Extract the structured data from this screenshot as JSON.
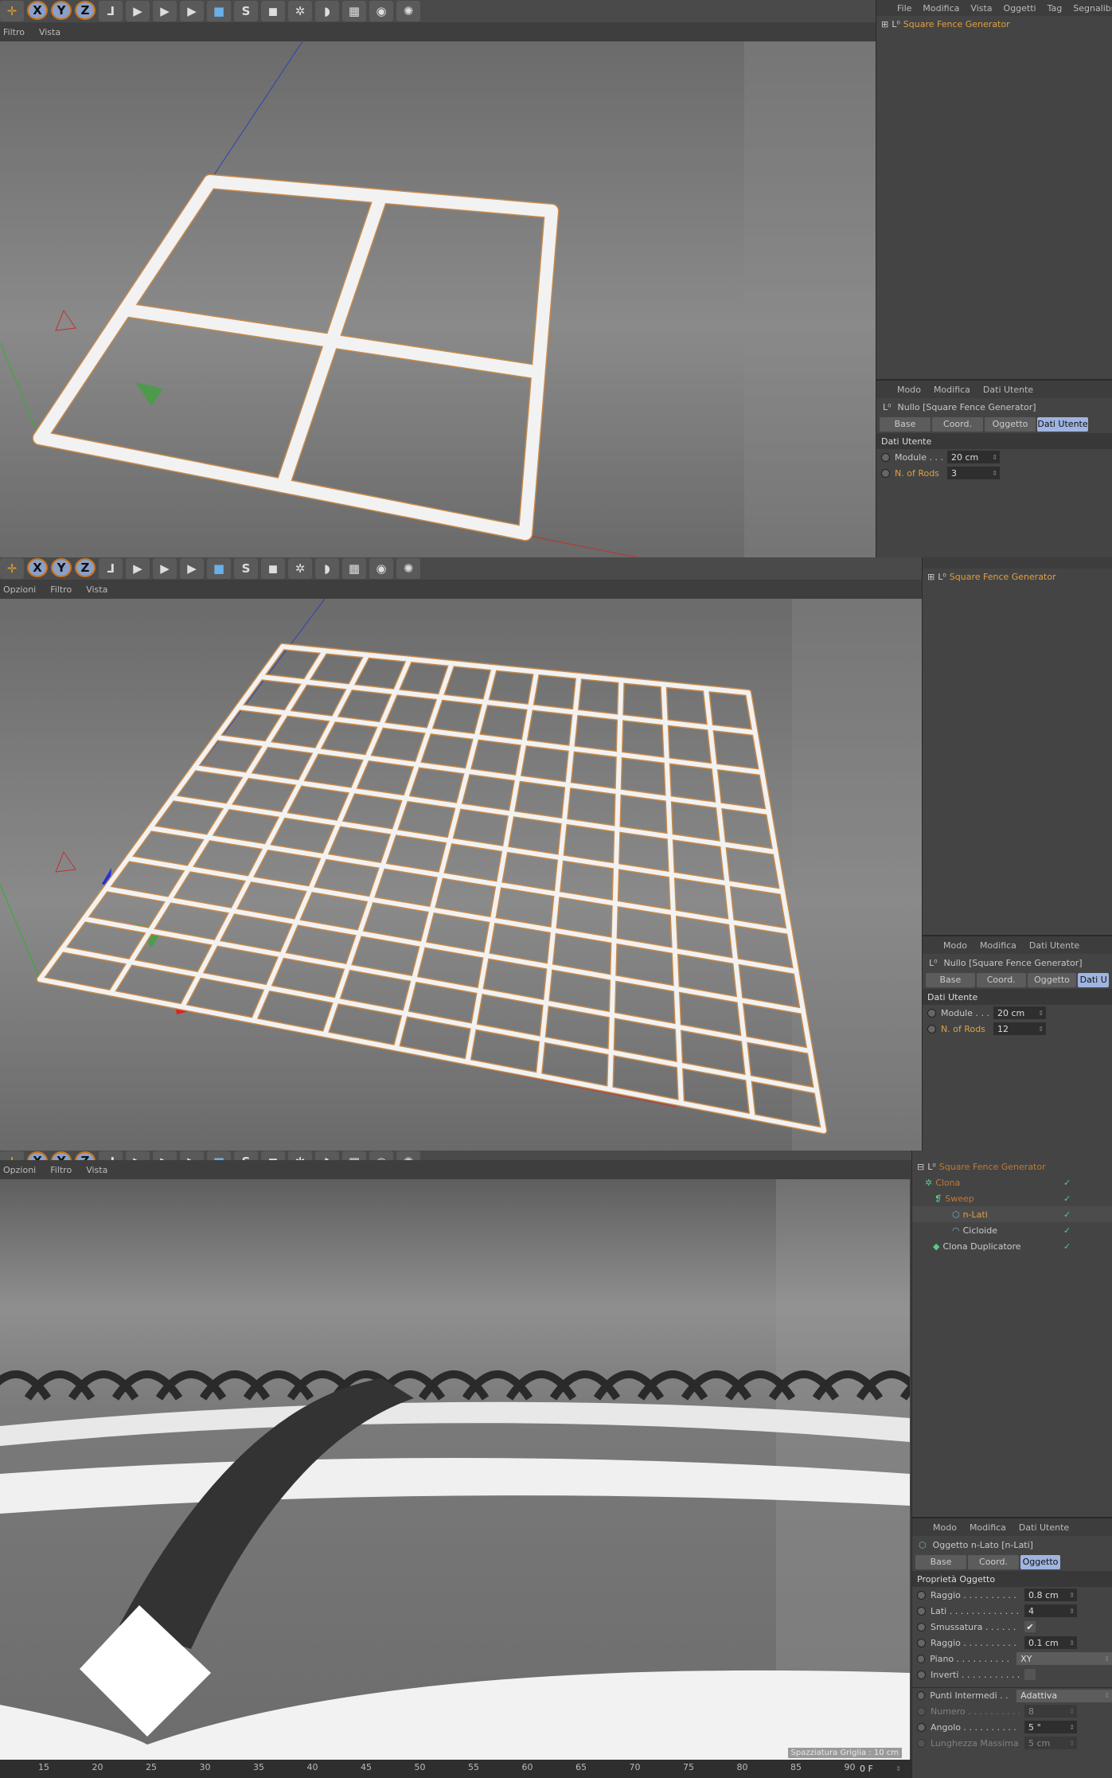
{
  "colors": {
    "accent": "#9fb4e0",
    "highlight": "#e0a040",
    "bg": "#414141"
  },
  "toolbar": {
    "icons": [
      "move-icon",
      "x-axis-icon",
      "y-axis-icon",
      "z-axis-icon",
      "coordinate-system-icon",
      "render-view-icon",
      "render-picture-viewer-icon",
      "render-settings-icon",
      "cube-icon",
      "spline-pen-icon",
      "subdivision-icon",
      "cloner-icon",
      "deformer-icon",
      "floor-icon",
      "camera-icon",
      "light-icon"
    ],
    "x": "X",
    "y": "Y",
    "z": "Z"
  },
  "viewport_menu": [
    "Opzioni",
    "Filtro",
    "Vista"
  ],
  "object_menu": [
    "File",
    "Modifica",
    "Vista",
    "Oggetti",
    "Tag",
    "Segnalibri"
  ],
  "panel1": {
    "objects": [
      {
        "name": "Square Fence Generator"
      }
    ],
    "attr_menu": [
      "Modo",
      "Modifica",
      "Dati Utente"
    ],
    "title": "Nullo [Square Fence Generator]",
    "tabs": [
      "Base",
      "Coord.",
      "Oggetto",
      "Dati Utente"
    ],
    "active_tab": "Dati Utente",
    "section": "Dati Utente",
    "module_label": "Module . . .",
    "module_value": "20 cm",
    "rods_label": "N. of Rods",
    "rods_value": "3"
  },
  "panel2": {
    "objects": [
      {
        "name": "Square Fence Generator"
      }
    ],
    "attr_menu": [
      "Modo",
      "Modifica",
      "Dati Utente"
    ],
    "title": "Nullo [Square Fence Generator]",
    "tabs": [
      "Base",
      "Coord.",
      "Oggetto",
      "Dati U"
    ],
    "section": "Dati Utente",
    "module_label": "Module . . .",
    "module_value": "20 cm",
    "rods_label": "N. of Rods",
    "rods_value": "12"
  },
  "panel3": {
    "objects": [
      {
        "name": "Square Fence Generator"
      },
      {
        "name": "Clona"
      },
      {
        "name": "Sweep"
      },
      {
        "name": "n-Lati"
      },
      {
        "name": "Cicloide"
      },
      {
        "name": "Clona Duplicatore"
      }
    ],
    "attr_menu": [
      "Modo",
      "Modifica",
      "Dati Utente"
    ],
    "title": "Oggetto n-Lato [n-Lati]",
    "tabs": [
      "Base",
      "Coord.",
      "Oggetto"
    ],
    "active_tab": "Oggetto",
    "section": "Proprietà Oggetto",
    "props": [
      {
        "label": "Raggio . . . . . . . . . . .",
        "value": "0.8 cm",
        "type": "num"
      },
      {
        "label": "Lati . . . . . . . . . . . . .",
        "value": "4",
        "type": "num"
      },
      {
        "label": "Smussatura . . . . . . .",
        "value": "✔",
        "type": "check"
      },
      {
        "label": "Raggio . . . . . . . . . . .",
        "value": "0.1 cm",
        "type": "num"
      },
      {
        "label": "Piano . . . . . . . . . . . .",
        "value": "XY",
        "type": "select"
      },
      {
        "label": "Inverti . . . . . . . . . . .",
        "value": "",
        "type": "checkoff"
      },
      {
        "label": "Punti Intermedi . . . .",
        "value": "Adattiva",
        "type": "select"
      },
      {
        "label": "Numero . . . . . . . . . .",
        "value": "8",
        "type": "numdim"
      },
      {
        "label": "Angolo . . . . . . . . . . .",
        "value": "5 °",
        "type": "num"
      },
      {
        "label": "Lunghezza Massima",
        "value": "5 cm",
        "type": "numdim"
      }
    ],
    "grid_spacing": "Spazziatura Griglia : 10 cm",
    "timeline": [
      "15",
      "20",
      "25",
      "30",
      "35",
      "40",
      "45",
      "50",
      "55",
      "60",
      "65",
      "70",
      "75",
      "80",
      "85",
      "90"
    ],
    "frame": "0 F"
  }
}
